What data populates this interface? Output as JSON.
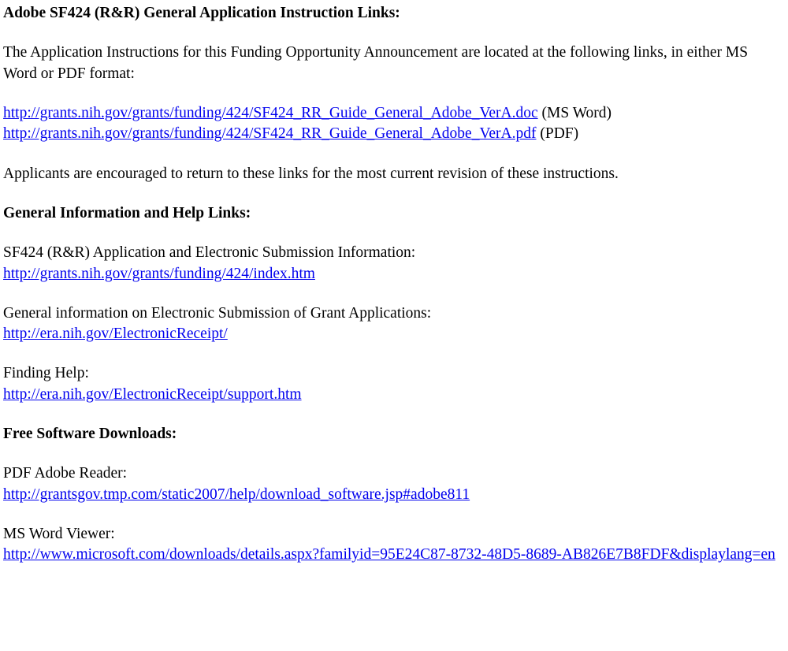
{
  "section1": {
    "heading": "Adobe SF424 (R&R) General Application Instruction Links:",
    "intro": "The Application Instructions for this Funding Opportunity Announcement are located at the following links, in either MS Word or PDF format:",
    "link1_text": "http://grants.nih.gov/grants/funding/424/SF424_RR_Guide_General_Adobe_VerA.doc",
    "link1_suffix": "  (MS Word)",
    "link2_text": "http://grants.nih.gov/grants/funding/424/SF424_RR_Guide_General_Adobe_VerA.pdf",
    "link2_suffix": "  (PDF)",
    "note": "Applicants are encouraged to return to these links for the most current revision of these instructions."
  },
  "section2": {
    "heading": "General Information and Help Links:",
    "item1_label": "SF424 (R&R) Application and Electronic Submission Information:",
    "item1_link": "http://grants.nih.gov/grants/funding/424/index.htm",
    "item2_label": "General information on Electronic Submission of Grant Applications:",
    "item2_link": "http://era.nih.gov/ElectronicReceipt/",
    "item3_label": "Finding Help:",
    "item3_link": "http://era.nih.gov/ElectronicReceipt/support.htm"
  },
  "section3": {
    "heading": "Free Software Downloads:",
    "item1_label": "PDF Adobe Reader:",
    "item1_link": "http://grantsgov.tmp.com/static2007/help/download_software.jsp#adobe811",
    "item2_label": "MS Word Viewer:",
    "item2_link": "http://www.microsoft.com/downloads/details.aspx?familyid=95E24C87-8732-48D5-8689-AB826E7B8FDF&displaylang=en"
  }
}
